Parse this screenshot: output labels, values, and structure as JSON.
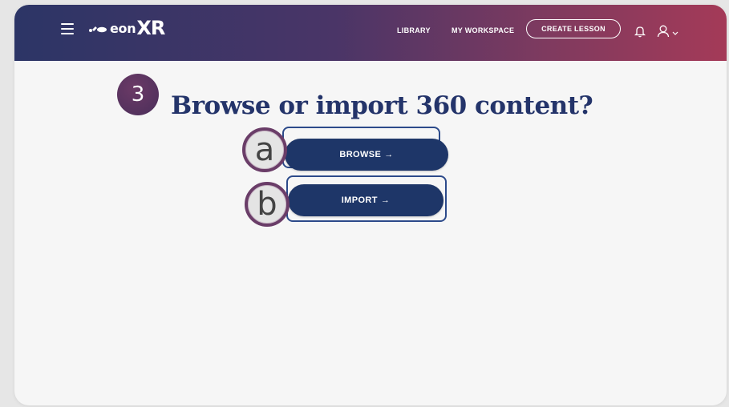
{
  "header": {
    "logo_text": "eon",
    "logo_xr": "XR",
    "nav": {
      "library": "LIBRARY",
      "workspace": "MY WORKSPACE",
      "create_lesson": "CREATE LESSON"
    }
  },
  "main": {
    "step_number": "3",
    "heading": "Browse or import 360 content?",
    "options": [
      {
        "badge": "a",
        "label": "BROWSE",
        "arrow": "→"
      },
      {
        "badge": "b",
        "label": "IMPORT",
        "arrow": "→"
      }
    ]
  },
  "colors": {
    "header_gradient_start": "#2c3566",
    "header_gradient_end": "#a43a58",
    "heading": "#24346a",
    "button": "#1e3668",
    "badge": "#4a2e5a"
  },
  "icons": [
    "menu-icon",
    "eon-logo-icon",
    "bell-icon",
    "user-icon",
    "chevron-down-icon"
  ]
}
